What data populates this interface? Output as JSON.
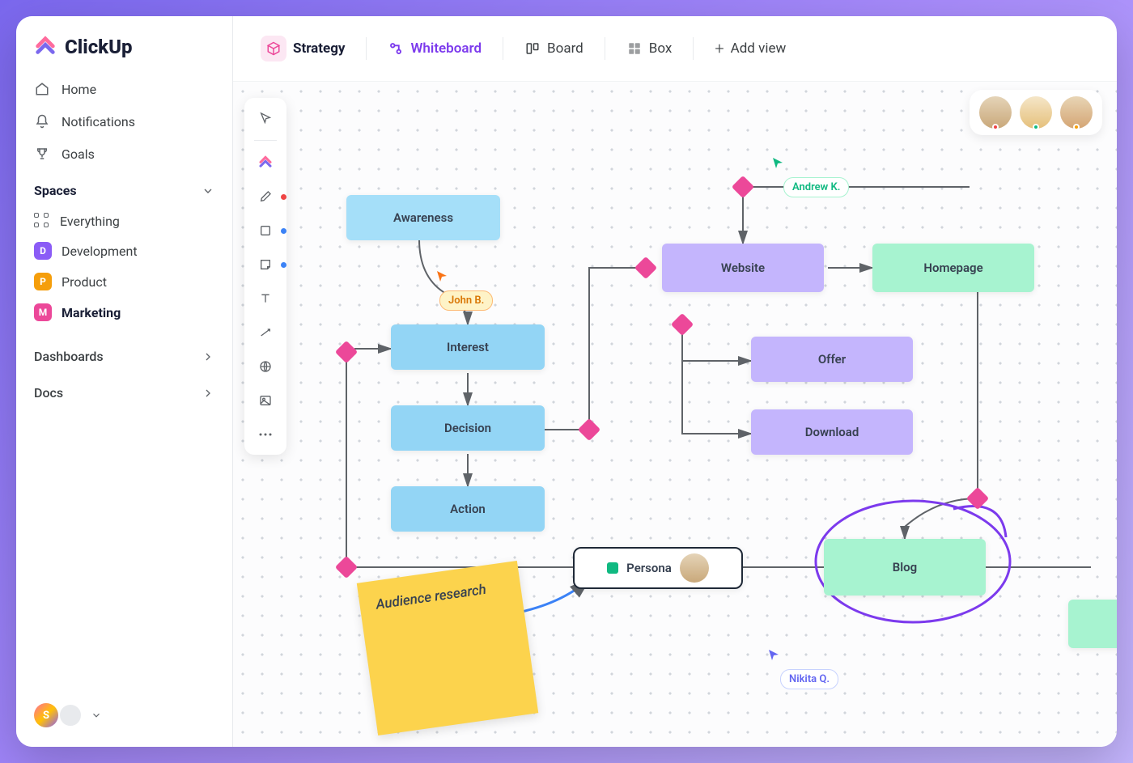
{
  "brand": {
    "name": "ClickUp"
  },
  "sidebar": {
    "nav": [
      {
        "label": "Home",
        "icon": "home-icon"
      },
      {
        "label": "Notifications",
        "icon": "bell-icon"
      },
      {
        "label": "Goals",
        "icon": "trophy-icon"
      }
    ],
    "spaces_header": "Spaces",
    "everything": "Everything",
    "spaces": [
      {
        "letter": "D",
        "label": "Development",
        "color": "#8B5CF6"
      },
      {
        "letter": "P",
        "label": "Product",
        "color": "#F59E0B"
      },
      {
        "letter": "M",
        "label": "Marketing",
        "color": "#EC4899",
        "active": true
      }
    ],
    "sections": [
      {
        "label": "Dashboards"
      },
      {
        "label": "Docs"
      }
    ],
    "footer_letter": "S"
  },
  "tabs": {
    "primary": "Strategy",
    "items": [
      {
        "label": "Whiteboard",
        "icon": "whiteboard-icon",
        "active": true
      },
      {
        "label": "Board",
        "icon": "board-icon"
      },
      {
        "label": "Box",
        "icon": "box-icon"
      }
    ],
    "add_view": "Add view"
  },
  "toolbar": {
    "tools": [
      "pointer",
      "clickup",
      "pen",
      "square",
      "note",
      "text",
      "connector",
      "web",
      "image",
      "more"
    ],
    "pen_dot_color": "#EF4444",
    "square_dot_color": "#3B82F6",
    "note_dot_color": "#3B82F6"
  },
  "presence": {
    "avatars": [
      {
        "dot_color": "#EF4444"
      },
      {
        "dot_color": "#10B981"
      },
      {
        "dot_color": "#F59E0B"
      }
    ]
  },
  "whiteboard": {
    "nodes": {
      "awareness": "Awareness",
      "interest": "Interest",
      "decision": "Decision",
      "action": "Action",
      "website": "Website",
      "offer": "Offer",
      "download": "Download",
      "homepage": "Homepage",
      "blog": "Blog",
      "persona": "Persona"
    },
    "sticky": "Audience research",
    "cursors": {
      "john": "John B.",
      "andrew": "Andrew K.",
      "nikita": "Nikita Q."
    }
  }
}
